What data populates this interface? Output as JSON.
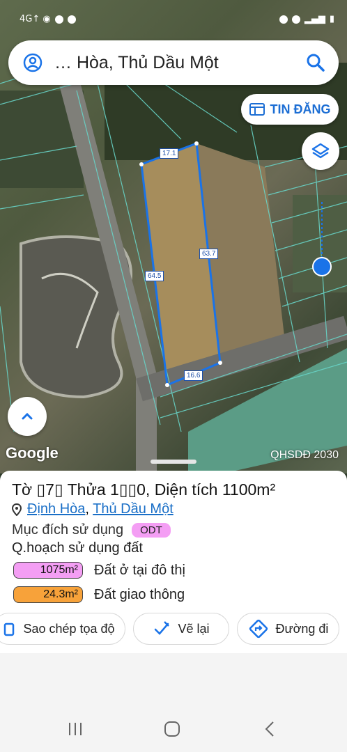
{
  "status_bar": {
    "left_text": "4G↑ ◉",
    "icons_left": [
      "facebook-icon",
      "facebook-icon"
    ],
    "icons_right": [
      "alarm-icon",
      "location-icon",
      "signal-icon",
      "battery-icon"
    ]
  },
  "search": {
    "query": "… Hòa, Thủ Dầu Một"
  },
  "map": {
    "tin_dang_label": "TIN ĐĂNG",
    "logo_text": "Google",
    "plan_label": "QHSDĐ 2030",
    "measurements": [
      "17.1",
      "63.7",
      "64.5",
      "16.6"
    ],
    "accent_color": "#1a73e8"
  },
  "info": {
    "title": "Tờ ▯7▯ Thửa 1▯▯0, Diện tích 1100m²",
    "ward": "Định Hòa",
    "separator": ",",
    "city": "Thủ Dầu Một",
    "purpose_label": "Mục đích sử dụng",
    "purpose_badge": "ODT",
    "planning_label": "Q.hoạch sử dụng đất",
    "planning_items": [
      {
        "area": "1075m²",
        "label": "Đất ở tại đô thị",
        "color": "#f49ef4"
      },
      {
        "area": "24.3m²",
        "label": "Đất giao thông",
        "color": "#f7a23a"
      }
    ]
  },
  "actions": {
    "copy_label": "Sao chép tọa độ",
    "redraw_label": "Vẽ lại",
    "directions_label": "Đường đi"
  }
}
